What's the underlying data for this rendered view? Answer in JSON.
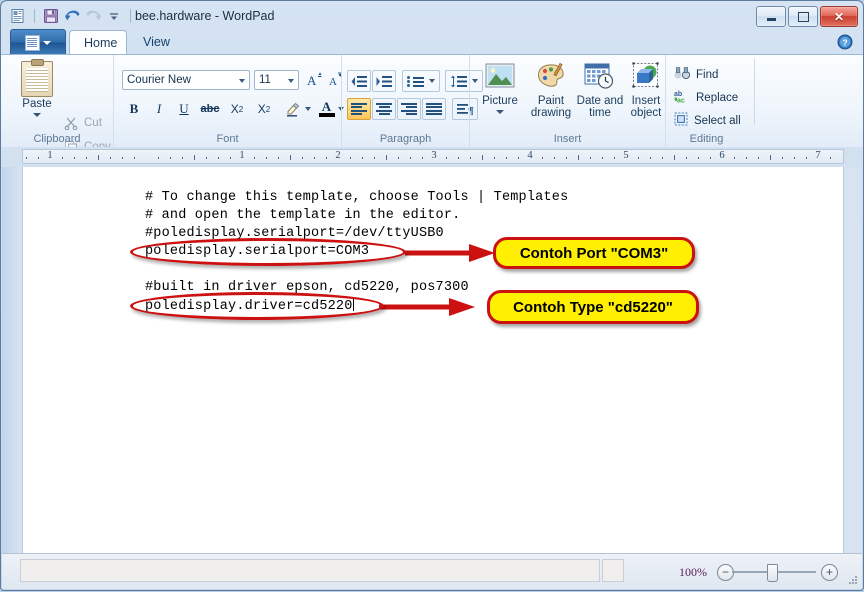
{
  "window": {
    "title": "bee.hardware - WordPad",
    "quick_access": [
      {
        "name": "wordpad-app-icon",
        "glyph": "document"
      },
      {
        "name": "save-icon",
        "glyph": "floppy"
      },
      {
        "name": "undo-icon",
        "glyph": "undo"
      },
      {
        "name": "redo-icon",
        "glyph": "redo"
      },
      {
        "name": "customize-qat-icon",
        "glyph": "chevron-down"
      }
    ],
    "buttons": {
      "minimize": "Minimize",
      "maximize": "Maximize",
      "close": "Close"
    }
  },
  "tabs": [
    {
      "label": "Home",
      "active": true
    },
    {
      "label": "View",
      "active": false
    }
  ],
  "help": {
    "label": "Help"
  },
  "ribbon": {
    "clipboard": {
      "label": "Clipboard",
      "paste": "Paste",
      "cut": "Cut",
      "copy": "Copy"
    },
    "font": {
      "label": "Font",
      "family": "Courier New",
      "size": "11",
      "grow": "Grow font",
      "shrink": "Shrink font",
      "bold": "B",
      "italic": "I",
      "underline": "U",
      "strikethrough": "abc",
      "subscript": "X",
      "superscript": "X",
      "highlight": "Text highlight color",
      "color": "A"
    },
    "paragraph": {
      "label": "Paragraph",
      "decrease_indent": "Decrease indent",
      "increase_indent": "Increase indent",
      "bullets": "Start a list",
      "line_spacing": "Line spacing",
      "align_left": "Align left",
      "align_center": "Center",
      "align_right": "Align right",
      "justify": "Justify",
      "paragraph_settings": "Paragraph"
    },
    "insert": {
      "label": "Insert",
      "items": [
        {
          "label1": "Picture",
          "label2": "",
          "icon": "picture-icon",
          "dropdown": true
        },
        {
          "label1": "Paint",
          "label2": "drawing",
          "icon": "paint-drawing-icon",
          "dropdown": false
        },
        {
          "label1": "Date and",
          "label2": "time",
          "icon": "date-and-time-icon",
          "dropdown": false
        },
        {
          "label1": "Insert",
          "label2": "object",
          "icon": "insert-object-icon",
          "dropdown": false
        }
      ]
    },
    "editing": {
      "label": "Editing",
      "find": "Find",
      "replace": "Replace",
      "select_all": "Select all"
    }
  },
  "ruler": {
    "numbers": [
      "1",
      "1",
      "2",
      "3",
      "4",
      "5",
      "7"
    ],
    "unit": "inch"
  },
  "document": {
    "lines": [
      "# To change this template, choose Tools | Templates",
      "# and open the template in the editor.",
      "#poledisplay.serialport=/dev/ttyUSB0",
      "poledisplay.serialport=COM3",
      "",
      "#built in driver epson, cd5220, pos7300",
      "poledisplay.driver=cd5220"
    ]
  },
  "annotations": {
    "accent_border": "#cc1111",
    "callout_fill": "#ffef00",
    "callouts": [
      {
        "name": "callout-port",
        "text": "Contoh Port \"COM3\""
      },
      {
        "name": "callout-type",
        "text": "Contoh Type \"cd5220\""
      }
    ],
    "highlights": [
      {
        "name": "highlight-serialport-line"
      },
      {
        "name": "highlight-driver-line"
      }
    ]
  },
  "status": {
    "zoom": "100%",
    "zoom_out": "−",
    "zoom_in": "+"
  }
}
